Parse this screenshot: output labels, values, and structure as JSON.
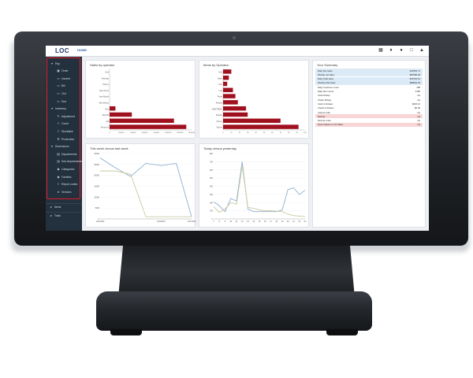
{
  "header": {
    "logo": "LOC",
    "section": "HOME"
  },
  "sidebar": {
    "items": [
      {
        "label": "Pay",
        "icon": "chevron-down-icon",
        "indent": 0
      },
      {
        "label": "Order",
        "icon": "cart-icon",
        "indent": 1
      },
      {
        "label": "Income",
        "icon": "document-icon",
        "indent": 1
      },
      {
        "label": "Bill",
        "icon": "document-icon",
        "indent": 1
      },
      {
        "label": "Ord",
        "icon": "document-icon",
        "indent": 1
      },
      {
        "label": "Due",
        "icon": "document-icon",
        "indent": 1
      },
      {
        "label": "Inventory",
        "icon": "chevron-down-icon",
        "indent": 0
      },
      {
        "label": "Adjustment",
        "icon": "pencil-icon",
        "indent": 1
      },
      {
        "label": "Count",
        "icon": "list-icon",
        "indent": 1
      },
      {
        "label": "Stocktake",
        "icon": "list-icon",
        "indent": 1
      },
      {
        "label": "Production",
        "icon": "gear-icon",
        "indent": 1
      },
      {
        "label": "Dimensions",
        "icon": "chevron-down-icon",
        "indent": 0
      },
      {
        "label": "Departments",
        "icon": "folder-icon",
        "indent": 1
      },
      {
        "label": "Sub-departments",
        "icon": "folder-icon",
        "indent": 1
      },
      {
        "label": "Categories",
        "icon": "tag-icon",
        "indent": 1
      },
      {
        "label": "Families",
        "icon": "tag-icon",
        "indent": 1
      },
      {
        "label": "Report codes",
        "icon": "list-icon",
        "indent": 1
      },
      {
        "label": "Vendors",
        "icon": "user-icon",
        "indent": 1
      }
    ],
    "lower_items": [
      {
        "label": "Items",
        "icon": "chevron-right-icon"
      },
      {
        "label": "Tools",
        "icon": "chevron-right-icon"
      }
    ]
  },
  "cards": {
    "sales_by_operator": {
      "title": "Sales by operator"
    },
    "items_by_operator": {
      "title": "Items by Operator"
    },
    "week": {
      "title": "This week versus last week"
    },
    "today": {
      "title": "Today versus yesterday"
    },
    "summary": {
      "title": "Your Summary",
      "rows": [
        {
          "label": "Daily Net sales",
          "value": "$14564.71",
          "tone": "blue"
        },
        {
          "label": "Weekly net sales",
          "value": "$87986.28",
          "tone": "blue"
        },
        {
          "label": "Daily Total sales",
          "value": "$15730.61",
          "tone": "blue"
        },
        {
          "label": "Weekly total sales",
          "value": "$89602.03",
          "tone": "blue"
        },
        {
          "label": "Daily Customer count",
          "value": "498",
          "tone": "white"
        },
        {
          "label": "Daily Item count",
          "value": "3786",
          "tone": "white"
        },
        {
          "label": "Cash Pickup",
          "value": "n/a",
          "tone": "white"
        },
        {
          "label": "Check Pickup",
          "value": "n/a",
          "tone": "white"
        },
        {
          "label": "Cash in Drawer",
          "value": "$415.13",
          "tone": "white"
        },
        {
          "label": "Check in Drawer",
          "value": "$0.00",
          "tone": "white"
        },
        {
          "label": "Cancel order",
          "value": "n/a",
          "tone": "white"
        },
        {
          "label": "Refund",
          "value": "n/a",
          "tone": "pink"
        },
        {
          "label": "Refund mode",
          "value": "n/a",
          "tone": "white"
        },
        {
          "label": "Open Drawer or No Sales",
          "value": "n/a",
          "tone": "pink"
        }
      ]
    }
  },
  "colors": {
    "bar": "#a0111f",
    "line_primary": "#8fb0cf",
    "line_secondary": "#c9caa2",
    "summary_blue": "#dbeaf7",
    "summary_pink": "#f8d6d6",
    "highlight": "#e11d2a"
  },
  "chart_data": [
    {
      "type": "bar",
      "orientation": "horizontal",
      "title": "Sales by operator",
      "categories": [
        "Kelli",
        "Fravinge",
        "Tammy",
        "Jean Pierre",
        "Yvan Boulet",
        "Alice Brown",
        "Amy",
        "Richard",
        "Sal",
        "Service N"
      ],
      "values": [
        0,
        0,
        0,
        0,
        0,
        0,
        10,
        38,
        110,
        131
      ],
      "xlim": [
        0,
        140
      ],
      "xticks": [
        "0",
        "200000",
        "400000",
        "600000",
        "800000",
        "1000000",
        "1200000",
        "1400000"
      ]
    },
    {
      "type": "bar",
      "orientation": "horizontal",
      "title": "Items by Operator",
      "categories": [
        "Kelli",
        "Adam",
        "Yvan",
        "Luis",
        "Frank",
        "Richard",
        "MONTREAL",
        "Claudia",
        "Tammy",
        "Steven"
      ],
      "values": [
        10,
        7,
        5,
        12,
        15,
        18,
        28,
        30,
        70,
        92
      ],
      "xlim": [
        0,
        100
      ],
      "xticks": [
        "0",
        "10",
        "20",
        "30",
        "40",
        "50",
        "60",
        "70",
        "80",
        "90",
        "100"
      ]
    },
    {
      "type": "line",
      "title": "This week versus last week",
      "x": [
        "1/21/2024",
        "1/22/2024",
        "1/23/2024",
        "1/24/2024",
        "1/25/2024",
        "1/26/2024",
        "1/27/2024"
      ],
      "xticks": [
        "1/21/2024",
        "1/25/2024",
        "1/27/2024"
      ],
      "ylim": [
        0,
        30000
      ],
      "yticks": [
        "30000",
        "25000",
        "20000",
        "15000",
        "10000",
        "5000",
        "0"
      ],
      "series": [
        {
          "values": [
            28000,
            23500,
            19500,
            25500,
            24500,
            25500,
            1000
          ]
        },
        {
          "values": [
            22000,
            22000,
            20500,
            1000,
            1000,
            1000,
            1000
          ]
        }
      ]
    },
    {
      "type": "line",
      "title": "Today versus yesterday",
      "x": [
        "7",
        "8",
        "9",
        "10",
        "11",
        "12",
        "13",
        "14",
        "15",
        "16",
        "17",
        "18",
        "19",
        "20",
        "21",
        "22",
        "23"
      ],
      "xticks": [
        "7",
        "8",
        "9",
        "10",
        "11",
        "12",
        "13",
        "14",
        "15",
        "16",
        "17",
        "18",
        "19",
        "20",
        "21",
        "22",
        "23"
      ],
      "ylim": [
        0,
        800
      ],
      "yticks": [
        "800",
        "700",
        "600",
        "500",
        "400",
        "300",
        "200",
        "100",
        "0"
      ],
      "series": [
        {
          "values": [
            210,
            160,
            90,
            250,
            220,
            700,
            120,
            90,
            90,
            90,
            90,
            90,
            110,
            360,
            380,
            300,
            350
          ]
        },
        {
          "values": [
            150,
            80,
            120,
            200,
            180,
            650,
            140,
            130,
            110,
            100,
            100,
            95,
            90,
            60,
            40,
            35,
            30
          ]
        }
      ]
    }
  ]
}
